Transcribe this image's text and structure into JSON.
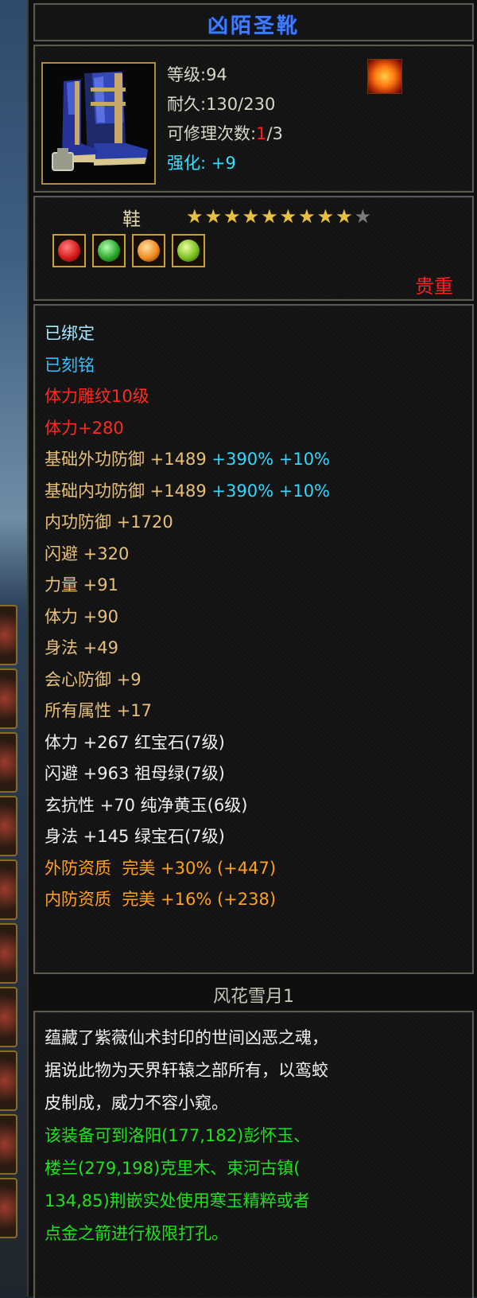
{
  "item": {
    "name": "凶陌圣靴",
    "level_label": "等级:94",
    "durability_label": "耐久:130/230",
    "repair_label": "可修理次数:",
    "repair_current": "1",
    "repair_max": "/3",
    "enhance_label": "强化:",
    "enhance_value": "+9",
    "type": "鞋",
    "stars_filled": 9,
    "stars_total": 10,
    "rarity": "贵重",
    "set_name": "风花雪月1"
  },
  "colors": {
    "title": "#3d7bff",
    "enhance": "#34e0ff",
    "rarity": "#ff2020",
    "base_attr": "#e8c07a",
    "percent": "#30d8ff",
    "quality": "#ffa020",
    "desc_green": "#20e020"
  },
  "gems": [
    {
      "icon": "red-gem-icon",
      "color": "#d81a1a"
    },
    {
      "icon": "green-gem-icon",
      "color": "#2ea82e"
    },
    {
      "icon": "orange-gem-icon",
      "color": "#f08a20"
    },
    {
      "icon": "jade-gem-icon",
      "color": "#7ac020"
    }
  ],
  "attributes": {
    "bound": "已绑定",
    "engraved": "已刻铭",
    "carving": "体力雕纹10级",
    "stamina_bonus": "体力+280",
    "outer_def": {
      "label": "基础外功防御 +1489",
      "pct1": "+390%",
      "pct2": "+10%"
    },
    "inner_def": {
      "label": "基础内功防御 +1489",
      "pct1": "+390%",
      "pct2": "+10%"
    },
    "stats": [
      "内功防御 +1720",
      "闪避 +320",
      "力量 +91",
      "体力 +90",
      "身法 +49",
      "会心防御 +9",
      "所有属性 +17"
    ],
    "gem_stats": [
      "体力 +267 红宝石(7级)",
      "闪避 +963 祖母绿(7级)",
      "玄抗性 +70 纯净黄玉(6级)",
      "身法 +145 绿宝石(7级)"
    ],
    "qualities": [
      "外防资质  完美 +30% (+447)",
      "内防资质  完美 +16% (+238)"
    ]
  },
  "description": {
    "lore": [
      "蕴藏了紫薇仙术封印的世间凶恶之魂，",
      "据说此物为天界轩辕之部所有，以鸾蛟",
      "皮制成，威力不容小窥。"
    ],
    "hint": [
      "该装备可到洛阳(177,182)彭怀玉、",
      "楼兰(279,198)克里木、束河古镇(",
      "134,85)荆嵌实处使用寒玉精粹或者",
      "点金之箭进行极限打孔。"
    ]
  }
}
